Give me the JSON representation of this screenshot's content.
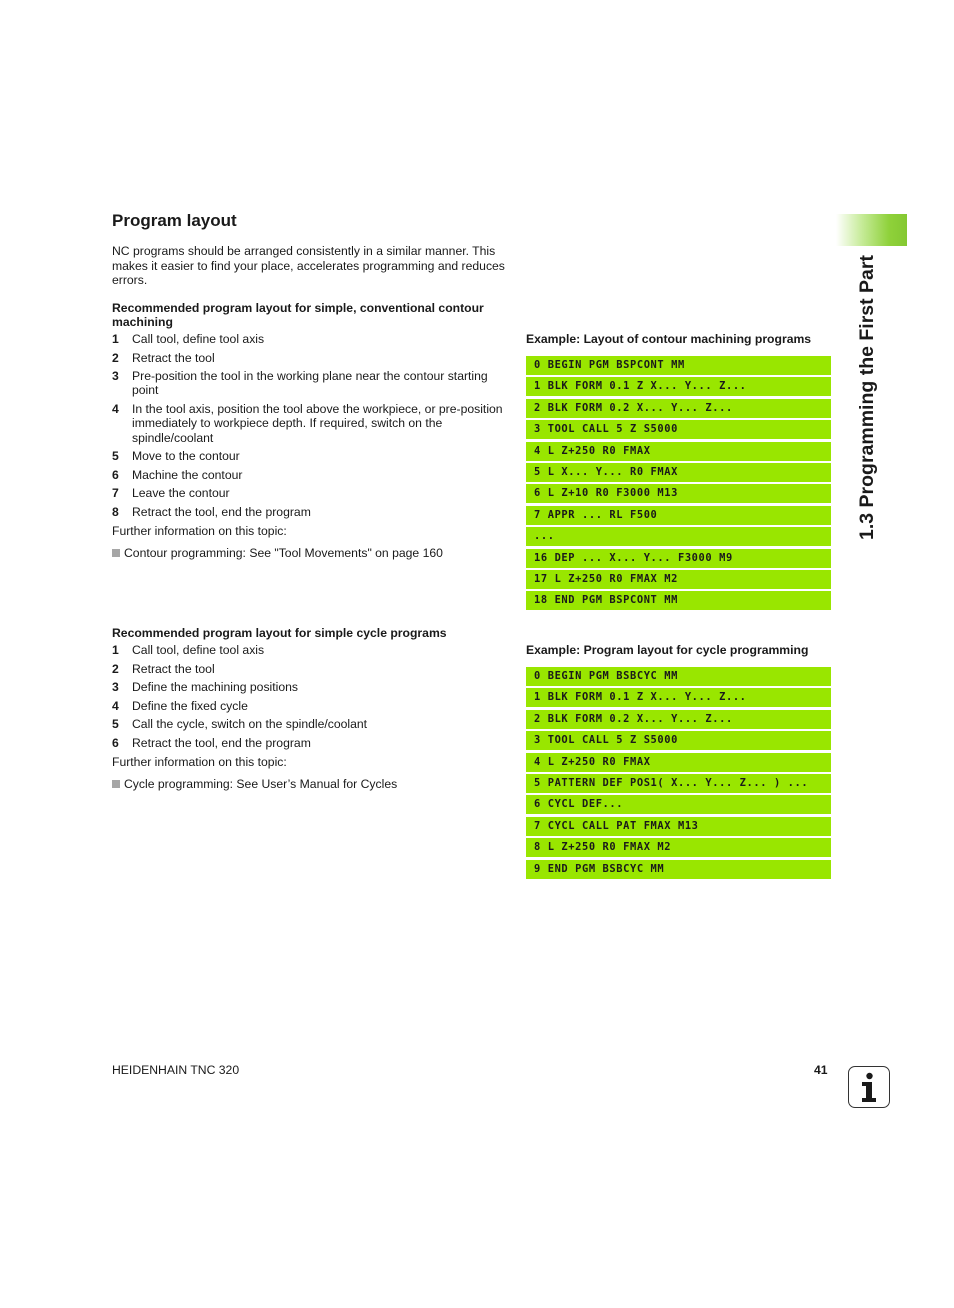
{
  "section": {
    "title": "Program layout",
    "intro": "NC programs should be arranged consistently in a similar manner. This makes it easier to find your place, accelerates programming and reduces errors."
  },
  "contour": {
    "heading": "Recommended program layout for simple, conventional contour machining",
    "steps": [
      {
        "num": "1",
        "text": "Call tool, define tool axis"
      },
      {
        "num": "2",
        "text": "Retract the tool"
      },
      {
        "num": "3",
        "text": "Pre-position the tool in the working plane near the contour starting point"
      },
      {
        "num": "4",
        "text": "In the tool axis, position the tool above the workpiece, or pre-position immediately to workpiece depth. If required, switch on the spindle/coolant"
      },
      {
        "num": "5",
        "text": "Move to the contour"
      },
      {
        "num": "6",
        "text": "Machine the contour"
      },
      {
        "num": "7",
        "text": "Leave the contour"
      },
      {
        "num": "8",
        "text": "Retract the tool, end the program"
      }
    ],
    "further": "Further information on this topic:",
    "reference": "Contour programming: See \"Tool Movements\" on page 160",
    "example_heading": "Example: Layout of contour machining programs",
    "code": [
      "0 BEGIN PGM BSPCONT MM",
      "1 BLK FORM 0.1 Z X... Y... Z...",
      "2 BLK FORM 0.2 X... Y... Z...",
      "3 TOOL CALL 5 Z S5000",
      "4 L Z+250 R0 FMAX",
      "5 L X... Y... R0 FMAX",
      "6 L Z+10 R0 F3000 M13",
      "7 APPR ... RL F500",
      "...",
      "16 DEP ... X... Y... F3000 M9",
      "17 L Z+250 R0 FMAX M2",
      "18 END PGM BSPCONT MM"
    ]
  },
  "cycle": {
    "heading": "Recommended program layout for simple cycle programs",
    "steps": [
      {
        "num": "1",
        "text": "Call tool, define tool axis"
      },
      {
        "num": "2",
        "text": "Retract the tool"
      },
      {
        "num": "3",
        "text": "Define the machining positions"
      },
      {
        "num": "4",
        "text": "Define the fixed cycle"
      },
      {
        "num": "5",
        "text": "Call the cycle, switch on the spindle/coolant"
      },
      {
        "num": "6",
        "text": "Retract the tool, end the program"
      }
    ],
    "further": "Further information on this topic:",
    "reference": "Cycle programming: See User’s Manual for Cycles",
    "example_heading": "Example: Program layout for cycle programming",
    "code": [
      "0 BEGIN PGM BSBCYC MM",
      "1 BLK FORM 0.1 Z X... Y... Z...",
      "2 BLK FORM 0.2 X... Y... Z...",
      "3 TOOL CALL 5 Z S5000",
      "4 L Z+250 R0 FMAX",
      "5 PATTERN DEF POS1( X... Y... Z... ) ...",
      "6 CYCL DEF...",
      "7 CYCL CALL PAT FMAX M13",
      "8 L Z+250 R0 FMAX M2",
      "9 END PGM BSBCYC MM"
    ]
  },
  "sidebar": {
    "chapter_title": "1.3 Programming the First Part"
  },
  "footer": {
    "product": "HEIDENHAIN TNC 320",
    "page_number": "41",
    "icon": "info-icon"
  },
  "colors": {
    "code_background": "#99e600",
    "tab_accent": "#84c832"
  }
}
